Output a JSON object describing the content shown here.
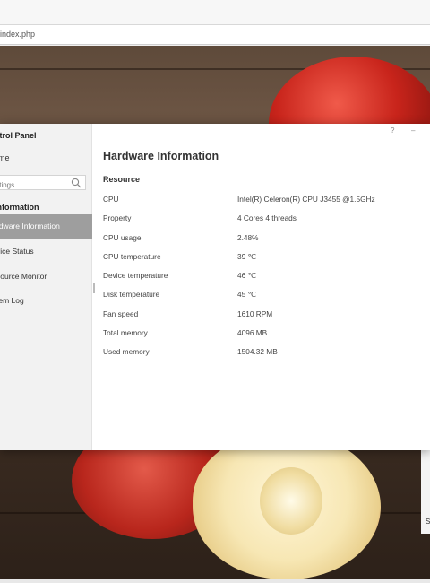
{
  "browser": {
    "url": "index.php"
  },
  "sidebar": {
    "title": "ntrol Panel",
    "home_label": "me",
    "search_placeholder": "ttings",
    "section_label": "Information",
    "items": [
      {
        "label": "rdware Information"
      },
      {
        "label": "vice Status"
      },
      {
        "label": "source Monitor"
      },
      {
        "label": "tem Log"
      }
    ]
  },
  "window_controls": {
    "help": "?",
    "minimize": "–"
  },
  "content": {
    "title": "Hardware Information",
    "section": "Resource",
    "rows": [
      {
        "key": "CPU",
        "value": "Intel(R) Celeron(R) CPU J3455 @1.5GHz"
      },
      {
        "key": "Property",
        "value": "4 Cores 4 threads"
      },
      {
        "key": "CPU usage",
        "value": "2.48%"
      },
      {
        "key": "CPU temperature",
        "value": "39 ℃"
      },
      {
        "key": "Device temperature",
        "value": "46 ℃"
      },
      {
        "key": "Disk temperature",
        "value": "45 ℃"
      },
      {
        "key": "Fan speed",
        "value": "1610 RPM"
      },
      {
        "key": "Total memory",
        "value": "4096 MB"
      },
      {
        "key": "Used memory",
        "value": "1504.32 MB"
      }
    ]
  },
  "desktop": {
    "right_edge_text": "S"
  },
  "colors": {
    "active_item_bg": "#9e9e9e",
    "sidebar_bg": "#f2f2f2"
  }
}
